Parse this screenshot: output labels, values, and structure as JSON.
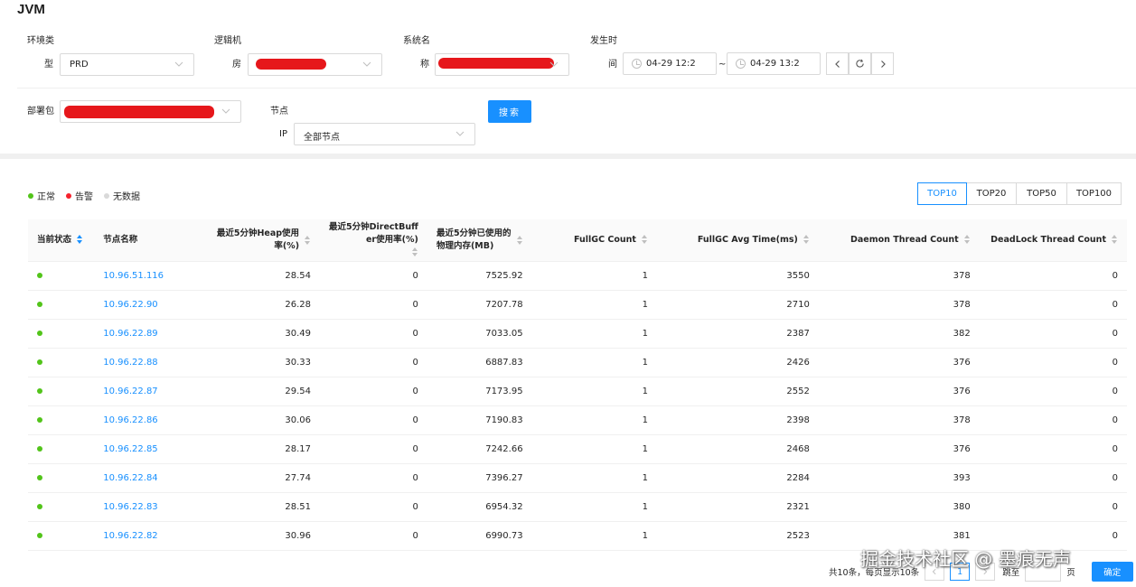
{
  "page_title": "JVM",
  "filters": {
    "env": {
      "label1": "环境类",
      "label2": "型",
      "value": "PRD"
    },
    "logic_room": {
      "label1": "逻辑机",
      "label2": "房"
    },
    "system": {
      "label1": "系统名",
      "label2": "称"
    },
    "time": {
      "label1": "发生时",
      "label2": "间",
      "start": "04-29 12:2",
      "sep": "~",
      "end": "04-29 13:2"
    },
    "package": {
      "label": "部署包"
    },
    "node": {
      "label1": "节点",
      "label2": "IP",
      "value": "全部节点"
    },
    "search_label": "搜索"
  },
  "legend": [
    {
      "label": "正常",
      "color": "#52c41a"
    },
    {
      "label": "告警",
      "color": "#f5222d"
    },
    {
      "label": "无数据",
      "color": "#d9d9d9"
    }
  ],
  "top_buttons": [
    "TOP10",
    "TOP20",
    "TOP50",
    "TOP100"
  ],
  "active_top": "TOP10",
  "table": {
    "headers": [
      "当前状态",
      "节点名称",
      "最近5分钟Heap使用\n率(%)",
      "最近5分钟DirectBuff\ner使用率(%)",
      "最近5分钟已使用的\n物理内存(MB)",
      "FullGC Count",
      "FullGC Avg Time(ms)",
      "Daemon Thread Count",
      "DeadLock Thread Count"
    ],
    "rows": [
      [
        "10.96.51.116",
        "28.54",
        "0",
        "7525.92",
        "1",
        "3550",
        "378",
        "0"
      ],
      [
        "10.96.22.90",
        "26.28",
        "0",
        "7207.78",
        "1",
        "2710",
        "378",
        "0"
      ],
      [
        "10.96.22.89",
        "30.49",
        "0",
        "7033.05",
        "1",
        "2387",
        "382",
        "0"
      ],
      [
        "10.96.22.88",
        "30.33",
        "0",
        "6887.83",
        "1",
        "2426",
        "376",
        "0"
      ],
      [
        "10.96.22.87",
        "29.54",
        "0",
        "7173.95",
        "1",
        "2552",
        "376",
        "0"
      ],
      [
        "10.96.22.86",
        "30.06",
        "0",
        "7190.83",
        "1",
        "2398",
        "378",
        "0"
      ],
      [
        "10.96.22.85",
        "28.17",
        "0",
        "7242.66",
        "1",
        "2468",
        "376",
        "0"
      ],
      [
        "10.96.22.84",
        "27.74",
        "0",
        "7396.27",
        "1",
        "2284",
        "393",
        "0"
      ],
      [
        "10.96.22.83",
        "28.51",
        "0",
        "6954.32",
        "1",
        "2321",
        "380",
        "0"
      ],
      [
        "10.96.22.82",
        "30.96",
        "0",
        "6990.73",
        "1",
        "2523",
        "381",
        "0"
      ]
    ]
  },
  "pagination": {
    "summary": "共10条，每页显示10条",
    "current": "1",
    "jump": "跳至",
    "page": "页",
    "ok": "确定"
  },
  "watermark": "掘金技术社区 @ 墨痕无声"
}
